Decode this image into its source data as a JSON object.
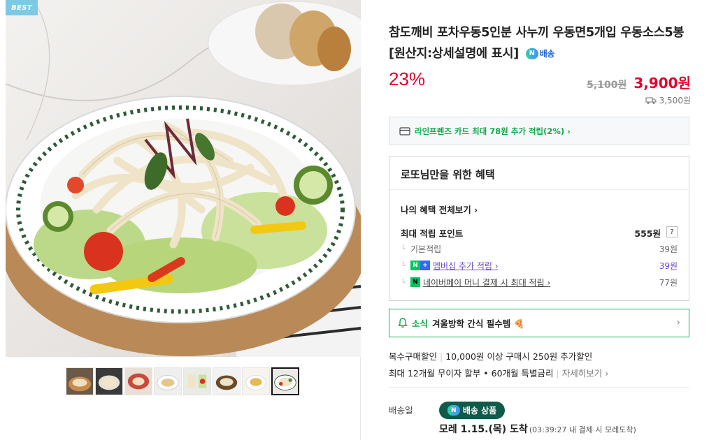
{
  "gallery": {
    "badge": "BEST",
    "thumbnail_count": 8,
    "active_thumbnail": 8
  },
  "product": {
    "title": "참도깨비 포차우동5인분 사누끼 우동면5개입 우동소스5봉 [원산지:상세설명에 표시]",
    "n_delivery_chip": "N",
    "n_delivery_label": "배송",
    "discount_rate": "23%",
    "original_price": "5,100원",
    "sale_price": "3,900원",
    "shipping_fee": "3,500원"
  },
  "card_promo": {
    "text": "라인프렌즈 카드 최대 78원 추가 적립(2%) ›"
  },
  "benefits": {
    "title": "로또님만을 위한 혜택",
    "my_benefits_link": "나의 혜택 전체보기 ›",
    "max_point_label": "최대 적립 포인트",
    "max_point_value": "555원",
    "help": "?",
    "rows": [
      {
        "label": "기본적립",
        "value": "39원"
      },
      {
        "label": "멤버십 추가 적립 ›",
        "value": "39원"
      },
      {
        "label": "네이버페이 머니 결제 시 최대 적립 ›",
        "value": "77원"
      }
    ]
  },
  "news": {
    "label": "소식",
    "text": "겨울방학 간식 필수템 🍕",
    "chevron": "›"
  },
  "promotions": {
    "bulk_label": "복수구매할인",
    "bulk_text": "10,000원 이상 구매시 250원 추가할인",
    "installment_text": "최대 12개월 무이자 할부 • 60개월 특별금리",
    "installment_more": "자세히보기 ›"
  },
  "delivery": {
    "label": "배송일",
    "badge_text": "배송 상품",
    "arrival_main": "모레 1.15.(목) 도착",
    "arrival_note": "(03:39:27 내 결제 시 모레도착)"
  },
  "colors": {
    "price_red": "#e4002b",
    "naver_green": "#13a74a",
    "membership_purple": "#6b46d6",
    "badge_blue": "#7ec9e4",
    "delivery_badge": "#105a4a"
  }
}
